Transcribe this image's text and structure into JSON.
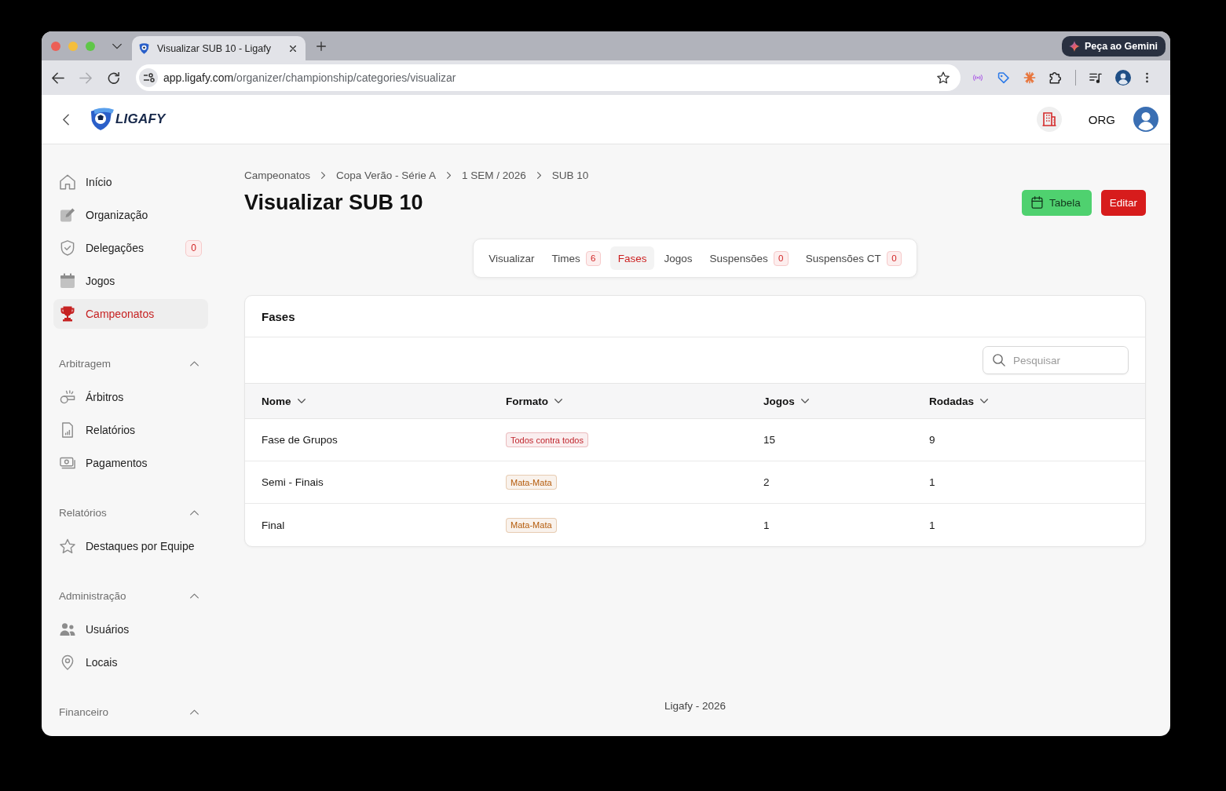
{
  "browser": {
    "tab_title": "Visualizar SUB 10 - Ligafy",
    "url": "app.ligafy.com/organizer/championship/categories/visualizar",
    "forward_disabled": true,
    "gemini_button": "Peça ao Gemini"
  },
  "header": {
    "logo_text": "LIGAFY",
    "org_label": "ORG"
  },
  "sidebar": {
    "items": [
      {
        "label": "Início",
        "selected": false
      },
      {
        "label": "Organização",
        "selected": false
      },
      {
        "label": "Delegações",
        "badge": "0",
        "selected": false
      },
      {
        "label": "Jogos",
        "selected": false
      },
      {
        "label": "Campeonatos",
        "selected": true
      }
    ],
    "sections": [
      {
        "title": "Arbitragem",
        "expanded": true,
        "items": [
          {
            "label": "Árbitros",
            "selected": false
          },
          {
            "label": "Relatórios",
            "selected": false
          },
          {
            "label": "Pagamentos",
            "selected": false
          }
        ]
      },
      {
        "title": "Relatórios",
        "expanded": true,
        "items": [
          {
            "label": "Destaques por Equipe",
            "selected": false
          }
        ]
      },
      {
        "title": "Administração",
        "expanded": true,
        "items": [
          {
            "label": "Usuários",
            "selected": false
          },
          {
            "label": "Locais",
            "selected": false
          }
        ]
      },
      {
        "title": "Financeiro",
        "expanded": true
      }
    ]
  },
  "breadcrumbs": [
    "Campeonatos",
    "Copa Verão - Série A",
    "1 SEM / 2026",
    "SUB 10"
  ],
  "page_title": "Visualizar SUB 10",
  "actions": [
    {
      "label": "Tabela",
      "kind": "success"
    },
    {
      "label": "Editar",
      "kind": "danger"
    }
  ],
  "tabs": [
    {
      "label": "Visualizar",
      "selected": false
    },
    {
      "label": "Times",
      "count": "6",
      "selected": false
    },
    {
      "label": "Fases",
      "selected": true
    },
    {
      "label": "Jogos",
      "selected": false
    },
    {
      "label": "Suspensões",
      "count": "0",
      "selected": false
    },
    {
      "label": "Suspensões CT",
      "count": "0",
      "selected": false
    }
  ],
  "phases_card": {
    "title": "Fases",
    "search": {
      "placeholder": "Pesquisar"
    },
    "table": {
      "columns": [
        "Nome",
        "Formato",
        "Jogos",
        "Rodadas"
      ],
      "rows": [
        {
          "name": "Fase de Grupos",
          "format": {
            "label": "Todos contra todos",
            "color": "#c0262d"
          },
          "games": "15",
          "rounds": "9"
        },
        {
          "name": "Semi - Finais",
          "format": {
            "label": "Mata-Mata",
            "color": "#b45a09"
          },
          "games": "2",
          "rounds": "1"
        },
        {
          "name": "Final",
          "format": {
            "label": "Mata-Mata",
            "color": "#b45a09"
          },
          "games": "1",
          "rounds": "1"
        }
      ]
    }
  },
  "footer": "Ligafy - 2026"
}
